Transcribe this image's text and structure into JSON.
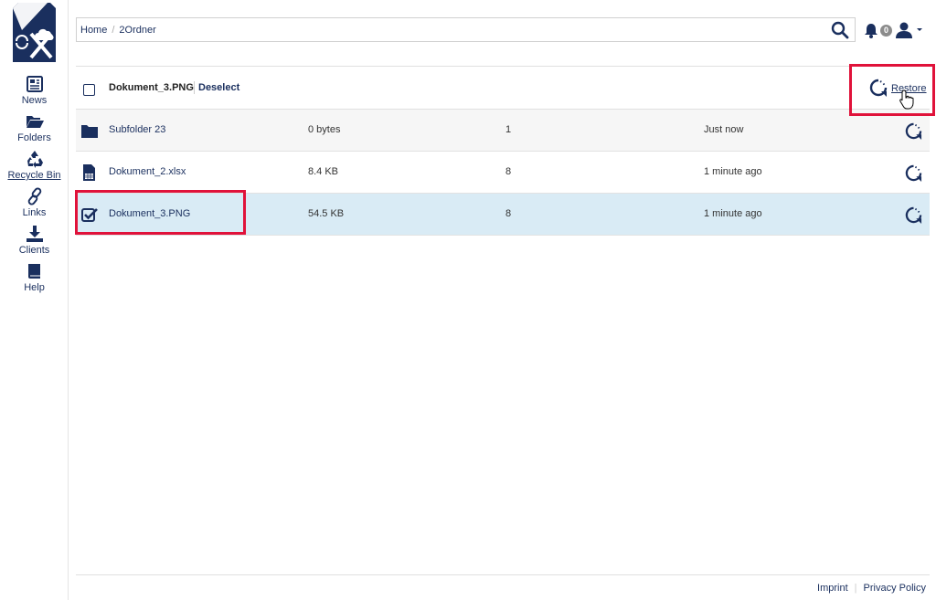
{
  "sidebar": {
    "logo_icon": "oxcloud-logo",
    "items": [
      {
        "label": "News",
        "icon": "newspaper-icon",
        "active": false
      },
      {
        "label": "Folders",
        "icon": "folder-open-icon",
        "active": false
      },
      {
        "label": "Recycle Bin",
        "icon": "recycle-icon",
        "active": true
      },
      {
        "label": "Links",
        "icon": "link-icon",
        "active": false
      },
      {
        "label": "Clients",
        "icon": "download-icon",
        "active": false
      },
      {
        "label": "Help",
        "icon": "book-icon",
        "active": false
      }
    ]
  },
  "header": {
    "breadcrumb": [
      "Home",
      "2Ordner"
    ],
    "search_icon": "search-icon",
    "notification_count": "0",
    "user_icon": "user-icon"
  },
  "selection_bar": {
    "selected_name": "Dokument_3.PNG",
    "deselect_label": "Deselect",
    "restore_label": "Restore"
  },
  "files": [
    {
      "name": "Subfolder 23",
      "size": "0 bytes",
      "versions": "1",
      "date": "Just now",
      "icon": "folder-icon",
      "selected": false
    },
    {
      "name": "Dokument_2.xlsx",
      "size": "8.4 KB",
      "versions": "8",
      "date": "1 minute ago",
      "icon": "spreadsheet-file-icon",
      "selected": false
    },
    {
      "name": "Dokument_3.PNG",
      "size": "54.5 KB",
      "versions": "8",
      "date": "1 minute ago",
      "icon": "checkbox-checked-icon",
      "selected": true
    }
  ],
  "footer": {
    "imprint": "Imprint",
    "privacy": "Privacy Policy"
  },
  "colors": {
    "brand": "#1a2f5e",
    "highlight": "#e0123a",
    "selected_row": "#d9ebf5"
  }
}
